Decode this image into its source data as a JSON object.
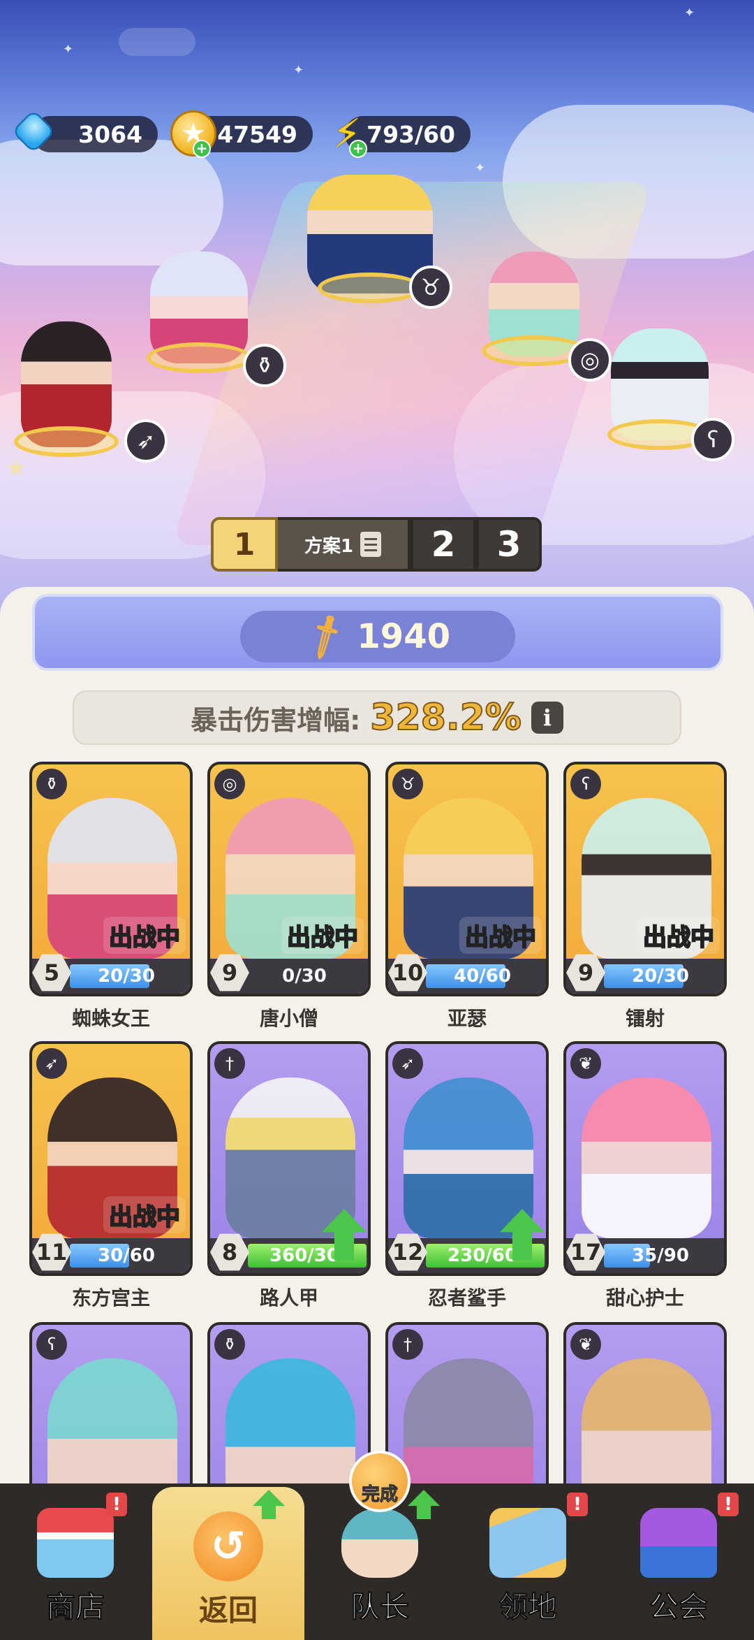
{
  "resources": {
    "gems": "3064",
    "coins": "47549",
    "energy": "793/60"
  },
  "plan_tabs": {
    "active": "1",
    "active_name": "方案1",
    "tab2": "2",
    "tab3": "3"
  },
  "power": "1940",
  "crit": {
    "label": "暴击伤害增幅:",
    "value": "328.2%"
  },
  "heroes": [
    {
      "name": "蜘蛛女王",
      "level": "5",
      "progress": "20/30",
      "fill": 0.67,
      "status": "出战中",
      "class_icon": "potion-icon",
      "frame": "gold"
    },
    {
      "name": "唐小僧",
      "level": "9",
      "progress": "0/30",
      "fill": 0.0,
      "status": "出战中",
      "class_icon": "spiral-icon",
      "frame": "gold"
    },
    {
      "name": "亚瑟",
      "level": "10",
      "progress": "40/60",
      "fill": 0.67,
      "status": "出战中",
      "class_icon": "horned-helmet-icon",
      "frame": "gold"
    },
    {
      "name": "镭射",
      "level": "9",
      "progress": "20/30",
      "fill": 0.67,
      "status": "出战中",
      "class_icon": "staff-icon",
      "frame": "gold"
    },
    {
      "name": "东方宫主",
      "level": "11",
      "progress": "30/60",
      "fill": 0.5,
      "status": "出战中",
      "class_icon": "bow-icon",
      "frame": "gold"
    },
    {
      "name": "路人甲",
      "level": "8",
      "progress": "360/30",
      "fill": 1.0,
      "status": "",
      "class_icon": "sword-icon",
      "frame": "purple",
      "upgradable": true
    },
    {
      "name": "忍者鲨手",
      "level": "12",
      "progress": "230/60",
      "fill": 1.0,
      "status": "",
      "class_icon": "bow-icon",
      "frame": "purple",
      "upgradable": true
    },
    {
      "name": "甜心护士",
      "level": "17",
      "progress": "35/90",
      "fill": 0.39,
      "status": "",
      "class_icon": "wings-icon",
      "frame": "purple"
    },
    {
      "name": "",
      "level": "",
      "progress": "",
      "class_icon": "staff-icon",
      "frame": "purple"
    },
    {
      "name": "",
      "level": "",
      "progress": "",
      "class_icon": "potion-icon",
      "frame": "purple"
    },
    {
      "name": "",
      "level": "",
      "progress": "",
      "class_icon": "sword-icon",
      "frame": "purple"
    },
    {
      "name": "",
      "level": "",
      "progress": "",
      "class_icon": "wings-icon",
      "frame": "purple"
    }
  ],
  "nav": {
    "shop": "商店",
    "back": "返回",
    "captain": "队长",
    "territory": "领地",
    "guild": "公会",
    "done_badge": "完成",
    "alert": "!"
  },
  "colors": {
    "gold_frame": "#f2a93a",
    "purple_frame": "#9a83e6",
    "power_banner": "#8f97ef",
    "crit_value": "#f0b638",
    "nav_bg": "#2e2a27"
  }
}
